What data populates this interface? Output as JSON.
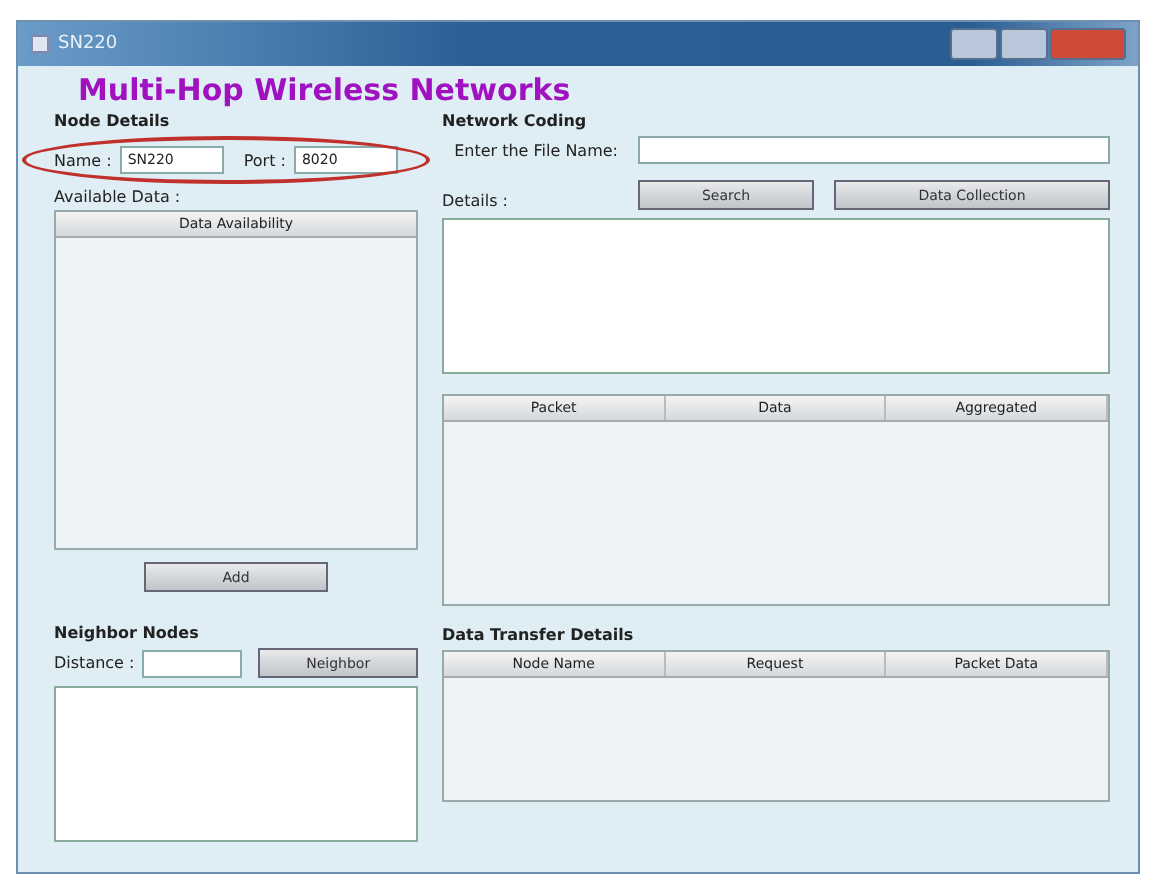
{
  "window": {
    "title": "SN220"
  },
  "app_title": "Multi-Hop Wireless Networks",
  "node_details": {
    "heading": "Node Details",
    "name_label": "Name :",
    "name_value": "SN220",
    "port_label": "Port :",
    "port_value": "8020",
    "available_label": "Available Data :",
    "list_header": "Data Availability",
    "add_button": "Add"
  },
  "neighbor_nodes": {
    "heading": "Neighbor Nodes",
    "distance_label": "Distance :",
    "neighbor_button": "Neighbor"
  },
  "network_coding": {
    "heading": "Network Coding",
    "file_label": "Enter the File Name:",
    "search_button": "Search",
    "collection_button": "Data Collection",
    "details_label": "Details :",
    "table": {
      "columns": [
        "Packet",
        "Data",
        "Aggregated"
      ]
    }
  },
  "data_transfer": {
    "heading": "Data Transfer Details",
    "table": {
      "columns": [
        "Node Name",
        "Request",
        "Packet Data"
      ]
    }
  }
}
